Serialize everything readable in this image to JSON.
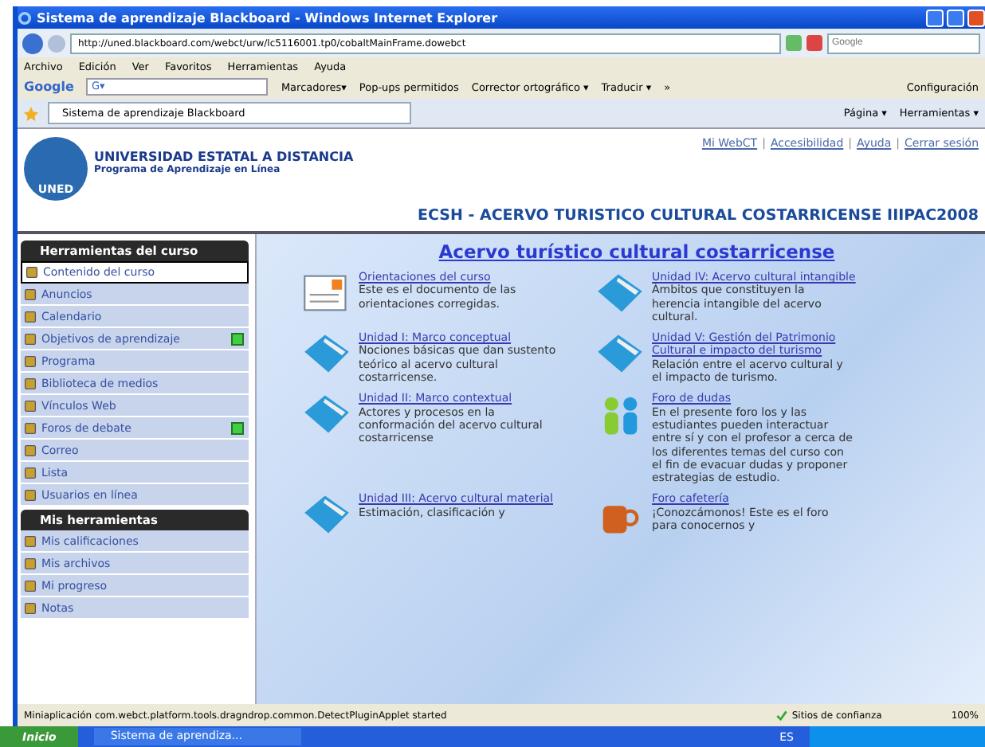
{
  "window": {
    "title": "Sistema de aprendizaje Blackboard - Windows Internet Explorer"
  },
  "address_bar": {
    "url": "http://uned.blackboard.com/webct/urw/lc5116001.tp0/cobaltMainFrame.dowebct",
    "search_placeholder": "Google"
  },
  "menu": [
    "Archivo",
    "Edición",
    "Ver",
    "Favoritos",
    "Herramientas",
    "Ayuda"
  ],
  "google_toolbar": {
    "logo": "Google",
    "search_prefix": "G▾",
    "items": [
      "Marcadores▾",
      "Pop-ups permitidos",
      "Corrector ortográfico ▾",
      "Traducir ▾",
      "»"
    ],
    "settings": "Configuración"
  },
  "tab": {
    "label": "Sistema de aprendizaje Blackboard"
  },
  "command_bar": [
    "Página ▾",
    "Herramientas ▾"
  ],
  "header": {
    "university": "UNIVERSIDAD ESTATAL A DISTANCIA",
    "program": "Programa de Aprendizaje en Línea",
    "logo_text": "UNED",
    "links": [
      "Mi WebCT",
      "Accesibilidad",
      "Ayuda",
      "Cerrar sesión"
    ],
    "separator": "|",
    "course_title": "ECSH - ACERVO TURISTICO CULTURAL COSTARRICENSE IIIPAC2008"
  },
  "sidebar": {
    "sections": [
      {
        "title": "Herramientas del curso",
        "items": [
          {
            "label": "Contenido del curso",
            "selected": true,
            "new": false
          },
          {
            "label": "Anuncios",
            "selected": false,
            "new": false
          },
          {
            "label": "Calendario",
            "selected": false,
            "new": false
          },
          {
            "label": "Objetivos de aprendizaje",
            "selected": false,
            "new": true
          },
          {
            "label": "Programa",
            "selected": false,
            "new": false
          },
          {
            "label": "Biblioteca de medios",
            "selected": false,
            "new": false
          },
          {
            "label": "Vínculos Web",
            "selected": false,
            "new": false
          },
          {
            "label": "Foros de debate",
            "selected": false,
            "new": true
          },
          {
            "label": "Correo",
            "selected": false,
            "new": false
          },
          {
            "label": "Lista",
            "selected": false,
            "new": false
          },
          {
            "label": "Usuarios en línea",
            "selected": false,
            "new": false
          }
        ]
      },
      {
        "title": "Mis herramientas",
        "items": [
          {
            "label": "Mis calificaciones",
            "selected": false,
            "new": false
          },
          {
            "label": "Mis archivos",
            "selected": false,
            "new": false
          },
          {
            "label": "Mi progreso",
            "selected": false,
            "new": false
          },
          {
            "label": "Notas",
            "selected": false,
            "new": false
          }
        ]
      }
    ]
  },
  "content": {
    "title": "Acervo turístico cultural costarricense",
    "items": [
      {
        "kind": "document",
        "title": "Orientaciones del curso",
        "description": "Este es el documento de las orientaciones corregidas."
      },
      {
        "kind": "folder",
        "title": "Unidad IV: Acervo cultural intangible",
        "description": "Ámbitos que constituyen la herencia intangible del acervo cultural."
      },
      {
        "kind": "folder",
        "title": "Unidad I: Marco conceptual",
        "description": "Nociones básicas que dan sustento teórico al acervo cultural costarricense."
      },
      {
        "kind": "folder",
        "title": "Unidad V: Gestión del Patrimonio Cultural e impacto del turismo",
        "description": "Relación entre el acervo cultural y el impacto de turismo."
      },
      {
        "kind": "folder",
        "title": "Unidad II: Marco contextual",
        "description": "Actores y procesos en la conformación del acervo cultural costarricense"
      },
      {
        "kind": "forum",
        "title": "Foro de dudas",
        "description": "En el presente foro los y las estudiantes pueden interactuar entre sí y con el profesor a cerca de los diferentes temas del curso con el fin de evacuar dudas y proponer estrategias de estudio."
      },
      {
        "kind": "folder",
        "title": "Unidad III: Acervo cultural material",
        "description": "Estimación, clasificación y"
      },
      {
        "kind": "cafe",
        "title": "Foro cafetería",
        "description": "¡Conozcámonos! Este es el foro para conocernos y"
      }
    ]
  },
  "status_bar": {
    "message": "Miniaplicación com.webct.platform.tools.dragndrop.common.DetectPluginApplet started",
    "zone": "Sitios de confianza",
    "zoom": "100%"
  },
  "taskbar": {
    "start": "Inicio",
    "window": "Sistema de aprendiza...",
    "language": "ES"
  }
}
